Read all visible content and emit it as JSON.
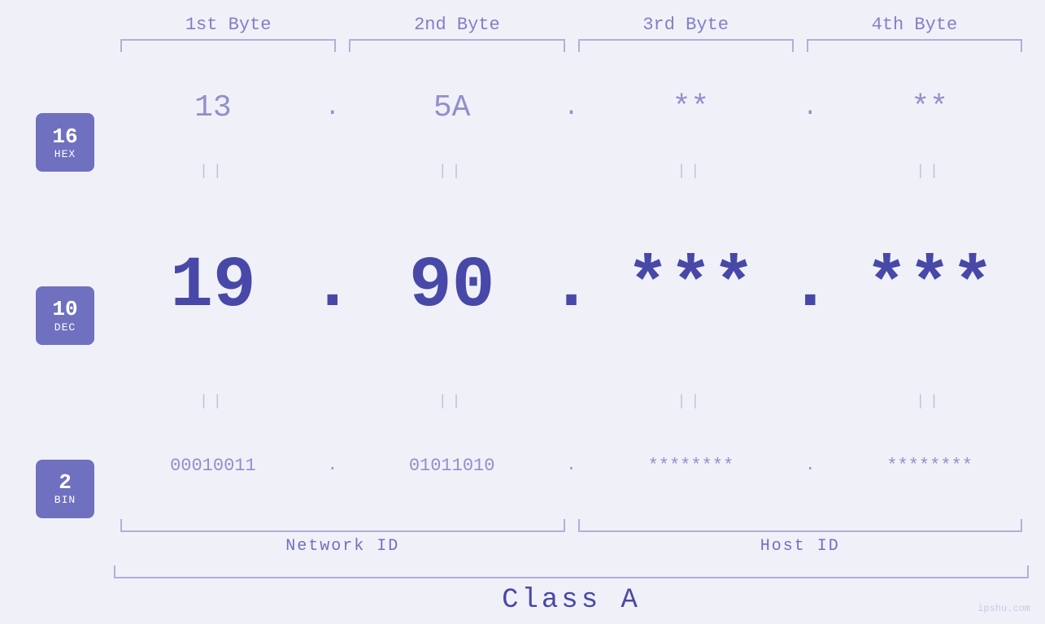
{
  "headers": {
    "byte1": "1st Byte",
    "byte2": "2nd Byte",
    "byte3": "3rd Byte",
    "byte4": "4th Byte"
  },
  "badges": {
    "hex": {
      "number": "16",
      "label": "HEX"
    },
    "dec": {
      "number": "10",
      "label": "DEC"
    },
    "bin": {
      "number": "2",
      "label": "BIN"
    }
  },
  "hex_row": {
    "b1": "13",
    "b2": "5A",
    "b3": "**",
    "b4": "**"
  },
  "dec_row": {
    "b1": "19",
    "b2": "90",
    "b3": "***",
    "b4": "***"
  },
  "bin_row": {
    "b1": "00010011",
    "b2": "01011010",
    "b3": "********",
    "b4": "********"
  },
  "labels": {
    "network_id": "Network ID",
    "host_id": "Host ID",
    "class": "Class A"
  },
  "watermark": "ipshu.com",
  "colors": {
    "accent": "#4848a8",
    "muted": "#9090cc",
    "bracket": "#b0b0d8",
    "bg": "#f0f0f8",
    "badge_bg": "#7070c0"
  }
}
